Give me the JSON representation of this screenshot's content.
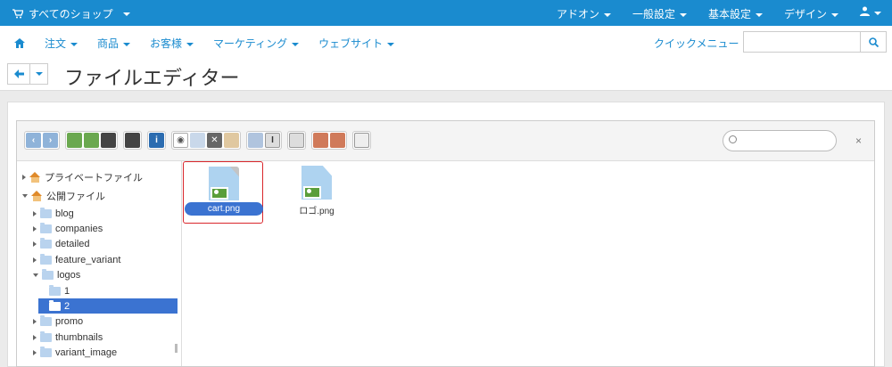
{
  "topbar": {
    "shop": "すべてのショップ",
    "menus": [
      "アドオン",
      "一般設定",
      "基本設定",
      "デザイン"
    ]
  },
  "navbar": {
    "menus": [
      "注文",
      "商品",
      "お客様",
      "マーケティング",
      "ウェブサイト"
    ],
    "quick_menu": "クイックメニュー",
    "search_placeholder": ""
  },
  "page": {
    "title": "ファイルエディター"
  },
  "tree": [
    {
      "label": "プライベートファイル",
      "expanded": false
    },
    {
      "label": "公開ファイル",
      "expanded": true
    },
    {
      "label": "blog"
    },
    {
      "label": "companies"
    },
    {
      "label": "detailed"
    },
    {
      "label": "feature_variant"
    },
    {
      "label": "logos",
      "expanded": true
    },
    {
      "label": "1"
    },
    {
      "label": "2",
      "selected": true
    },
    {
      "label": "promo"
    },
    {
      "label": "thumbnails"
    },
    {
      "label": "variant_image"
    }
  ],
  "files": [
    {
      "name": "cart.png",
      "selected": true
    },
    {
      "name": "ロゴ.png"
    }
  ],
  "file_search": {
    "placeholder": ""
  },
  "close_glyph": "×",
  "colors": {
    "topbar": "#1a8bcf",
    "selection": "#3b73d1",
    "highlight_border": "#d9262b"
  }
}
